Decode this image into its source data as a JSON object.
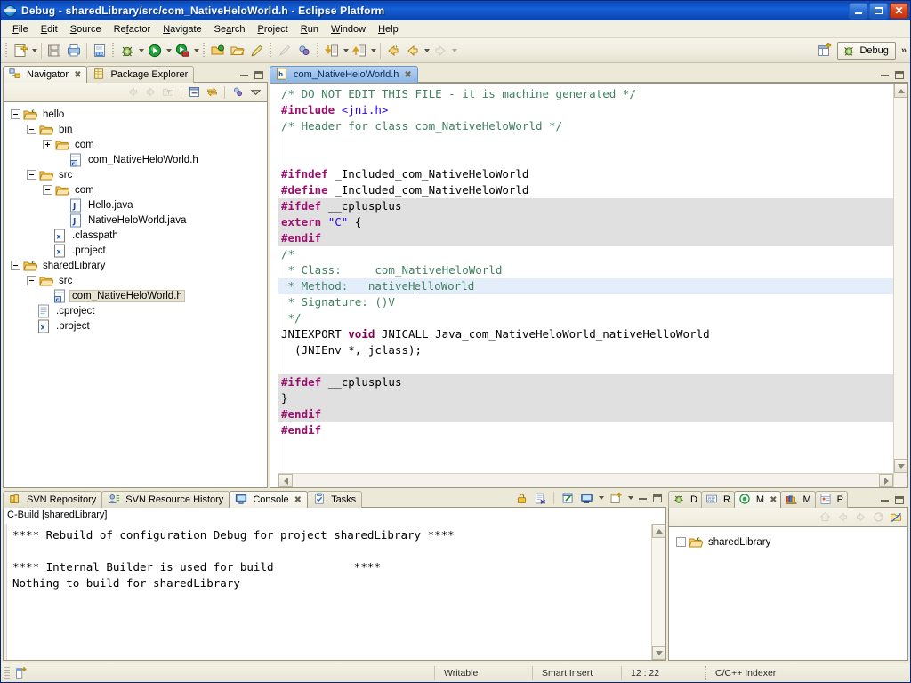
{
  "window": {
    "title": "Debug - sharedLibrary/src/com_NativeHeloWorld.h - Eclipse Platform",
    "icon": "eclipse-globe-icon",
    "minimize_label": "",
    "maximize_label": "",
    "close_label": "✕"
  },
  "menubar": {
    "items": [
      {
        "label": "File"
      },
      {
        "label": "Edit"
      },
      {
        "label": "Source"
      },
      {
        "label": "Refactor"
      },
      {
        "label": "Navigate"
      },
      {
        "label": "Search"
      },
      {
        "label": "Project"
      },
      {
        "label": "Run"
      },
      {
        "label": "Window"
      },
      {
        "label": "Help"
      }
    ]
  },
  "toolbar": {
    "groups": [
      [
        "new-wizard-icon",
        "dropdown-arrow"
      ],
      [
        "save-icon",
        "print-icon"
      ],
      [
        "toggle-hex-icon"
      ],
      [
        "debug-icon",
        "dropdown-arrow",
        "run-icon",
        "dropdown-arrow",
        "external-tools-icon",
        "dropdown-arrow"
      ],
      [
        "open-type-icon",
        "open-resource-icon",
        "pencil-icon"
      ],
      [
        "search-icon",
        "link-icon"
      ],
      [
        "next-annotation-icon",
        "dropdown-arrow",
        "previous-annotation-icon",
        "dropdown-arrow"
      ],
      [
        "back-icon",
        "forward-icon",
        "dropdown-arrow",
        "forward-disabled-icon",
        "dropdown-arrow"
      ]
    ],
    "perspective_open_icon": "open-perspective-icon",
    "perspective_label": "Debug",
    "perspective_icon": "debug-perspective-icon",
    "overflow_label": "»"
  },
  "navigator": {
    "tabs": [
      {
        "label": "Navigator",
        "icon": "navigator-icon",
        "active": true,
        "closable": true
      },
      {
        "label": "Package Explorer",
        "icon": "package-explorer-icon",
        "active": false,
        "closable": false
      }
    ],
    "toolbar_icons": [
      "back-icon",
      "forward-icon",
      "up-icon",
      "collapse-all-icon",
      "link-with-editor-icon",
      "view-menu-filter-icon",
      "view-menu-icon"
    ],
    "minimize_label": "",
    "maximize_label": "",
    "tree": [
      {
        "label": "hello",
        "depth": 0,
        "expander": "minus",
        "icon": "project-folder-icon",
        "selected": false
      },
      {
        "label": "bin",
        "depth": 1,
        "expander": "minus",
        "icon": "folder-icon",
        "selected": false
      },
      {
        "label": "com",
        "depth": 2,
        "expander": "plus",
        "icon": "folder-icon",
        "selected": false
      },
      {
        "label": "com_NativeHeloWorld.h",
        "depth": 3,
        "expander": "none",
        "icon": "c-header-icon",
        "selected": false
      },
      {
        "label": "src",
        "depth": 1,
        "expander": "minus",
        "icon": "folder-icon",
        "selected": false
      },
      {
        "label": "com",
        "depth": 2,
        "expander": "minus",
        "icon": "folder-icon",
        "selected": false
      },
      {
        "label": "Hello.java",
        "depth": 3,
        "expander": "none",
        "icon": "java-file-icon",
        "selected": false
      },
      {
        "label": "NativeHeloWorld.java",
        "depth": 3,
        "expander": "none",
        "icon": "java-file-icon",
        "selected": false
      },
      {
        "label": ".classpath",
        "depth": 2,
        "expander": "none",
        "icon": "xml-file-icon",
        "selected": false
      },
      {
        "label": ".project",
        "depth": 2,
        "expander": "none",
        "icon": "xml-file-icon",
        "selected": false
      },
      {
        "label": "sharedLibrary",
        "depth": 0,
        "expander": "minus",
        "icon": "project-folder-icon",
        "selected": false
      },
      {
        "label": "src",
        "depth": 1,
        "expander": "minus",
        "icon": "folder-icon",
        "selected": false
      },
      {
        "label": "com_NativeHeloWorld.h",
        "depth": 2,
        "expander": "none",
        "icon": "c-header-icon",
        "selected": true
      },
      {
        "label": ".cproject",
        "depth": 1,
        "expander": "none",
        "icon": "text-file-icon",
        "selected": false
      },
      {
        "label": ".project",
        "depth": 1,
        "expander": "none",
        "icon": "xml-file-icon",
        "selected": false
      }
    ]
  },
  "editor": {
    "tab": {
      "label": "com_NativeHeloWorld.h",
      "icon": "h-file-icon",
      "active": true,
      "closable": true
    },
    "minimize_label": "",
    "maximize_label": "",
    "lines": [
      {
        "bg": "normal",
        "segments": [
          {
            "t": "/* DO NOT EDIT THIS FILE - it is machine generated */",
            "c": "cm"
          }
        ]
      },
      {
        "bg": "normal",
        "segments": [
          {
            "t": "#include ",
            "c": "k"
          },
          {
            "t": "<jni.h>",
            "c": "st"
          }
        ]
      },
      {
        "bg": "normal",
        "segments": [
          {
            "t": "/* Header for class com_NativeHeloWorld */",
            "c": "cm"
          }
        ]
      },
      {
        "bg": "normal",
        "segments": [
          {
            "t": "",
            "c": "pl"
          }
        ]
      },
      {
        "bg": "normal",
        "segments": [
          {
            "t": "",
            "c": "pl"
          }
        ]
      },
      {
        "bg": "normal",
        "segments": [
          {
            "t": "#ifndef ",
            "c": "k"
          },
          {
            "t": "_Included_com_NativeHeloWorld",
            "c": "pl"
          }
        ]
      },
      {
        "bg": "normal",
        "segments": [
          {
            "t": "#define ",
            "c": "k"
          },
          {
            "t": "_Included_com_NativeHeloWorld",
            "c": "pl"
          }
        ]
      },
      {
        "bg": "inactive",
        "segments": [
          {
            "t": "#ifdef ",
            "c": "k"
          },
          {
            "t": "__cplusplus",
            "c": "pl"
          }
        ]
      },
      {
        "bg": "inactive",
        "segments": [
          {
            "t": "extern ",
            "c": "k"
          },
          {
            "t": "\"C\"",
            "c": "st"
          },
          {
            "t": " {",
            "c": "pl"
          }
        ]
      },
      {
        "bg": "inactive",
        "segments": [
          {
            "t": "#endif",
            "c": "k"
          }
        ]
      },
      {
        "bg": "normal",
        "segments": [
          {
            "t": "/*",
            "c": "cm"
          }
        ]
      },
      {
        "bg": "normal",
        "segments": [
          {
            "t": " * Class:     com_NativeHeloWorld",
            "c": "cm"
          }
        ]
      },
      {
        "bg": "current",
        "segments": [
          {
            "t": " * Method:   nativeH",
            "c": "cm"
          },
          {
            "t": "|CARET|",
            "c": "caret"
          },
          {
            "t": "elloWorld",
            "c": "cm"
          }
        ]
      },
      {
        "bg": "normal",
        "segments": [
          {
            "t": " * Signature: ()V",
            "c": "cm"
          }
        ]
      },
      {
        "bg": "normal",
        "segments": [
          {
            "t": " */",
            "c": "cm"
          }
        ]
      },
      {
        "bg": "normal",
        "segments": [
          {
            "t": "JNIEXPORT ",
            "c": "pl"
          },
          {
            "t": "void",
            "c": "kw"
          },
          {
            "t": " JNICALL Java_com_NativeHeloWorld_nativeHelloWorld",
            "c": "pl"
          }
        ]
      },
      {
        "bg": "normal",
        "segments": [
          {
            "t": "  (JNIEnv *, jclass);",
            "c": "pl"
          }
        ]
      },
      {
        "bg": "normal",
        "segments": [
          {
            "t": "",
            "c": "pl"
          }
        ]
      },
      {
        "bg": "inactive",
        "segments": [
          {
            "t": "#ifdef ",
            "c": "k"
          },
          {
            "t": "__cplusplus",
            "c": "pl"
          }
        ]
      },
      {
        "bg": "inactive",
        "segments": [
          {
            "t": "}",
            "c": "pl"
          }
        ]
      },
      {
        "bg": "inactive",
        "segments": [
          {
            "t": "#endif",
            "c": "k"
          }
        ]
      },
      {
        "bg": "normal",
        "segments": [
          {
            "t": "#endif",
            "c": "k"
          }
        ]
      }
    ]
  },
  "console": {
    "tabs": [
      {
        "label": "SVN Repository",
        "icon": "svn-repository-icon",
        "active": false,
        "closable": false
      },
      {
        "label": "SVN Resource History",
        "icon": "svn-resource-history-icon",
        "active": false,
        "closable": false
      },
      {
        "label": "Console",
        "icon": "console-icon",
        "active": true,
        "closable": true
      },
      {
        "label": "Tasks",
        "icon": "tasks-icon",
        "active": false,
        "closable": false
      }
    ],
    "toolbar_icons": [
      "lock-scroll-icon",
      "clear-console-icon",
      "pin-console-icon",
      "display-console-icon",
      "dropdown-arrow",
      "open-console-icon",
      "dropdown-arrow"
    ],
    "minimize_label": "",
    "maximize_label": "",
    "header": "C-Build [sharedLibrary]",
    "output": "**** Rebuild of configuration Debug for project sharedLibrary ****\n\n**** Internal Builder is used for build            ****\nNothing to build for sharedLibrary"
  },
  "make_targets": {
    "tabs": [
      {
        "label": "D",
        "icon": "debug-view-icon",
        "active": false,
        "closable": false
      },
      {
        "label": "R",
        "icon": "registers-view-icon",
        "active": false,
        "closable": false
      },
      {
        "label": "M",
        "icon": "make-targets-icon",
        "active": true,
        "closable": true
      },
      {
        "label": "M",
        "icon": "modules-view-icon",
        "active": false,
        "closable": false
      },
      {
        "label": "P",
        "icon": "properties-view-icon",
        "active": false,
        "closable": false
      }
    ],
    "toolbar_icons": [
      "home-icon",
      "back-icon",
      "forward-icon",
      "refresh-icon",
      "add-target-icon"
    ],
    "minimize_label": "",
    "maximize_label": "",
    "tree": [
      {
        "label": "sharedLibrary",
        "depth": 0,
        "expander": "plus",
        "icon": "project-folder-icon"
      }
    ]
  },
  "statusbar": {
    "icon": "editing-icon",
    "cells": [
      {
        "label": "Writable"
      },
      {
        "label": "Smart Insert"
      },
      {
        "label": "12 : 22"
      },
      {
        "label": "C/C++ Indexer"
      }
    ]
  },
  "colors": {
    "title_blue": "#0a49b8",
    "chrome": "#ece9d8",
    "panel_border": "#9a9582",
    "active_tab_blue": "#9dc1ea",
    "comment_green": "#3f7f5f",
    "preproc_magenta": "#9a0f6e",
    "string_blue": "#2a00ff",
    "inactive_code_grey": "#e0e0e0",
    "current_line_blue": "#e4eefb"
  }
}
